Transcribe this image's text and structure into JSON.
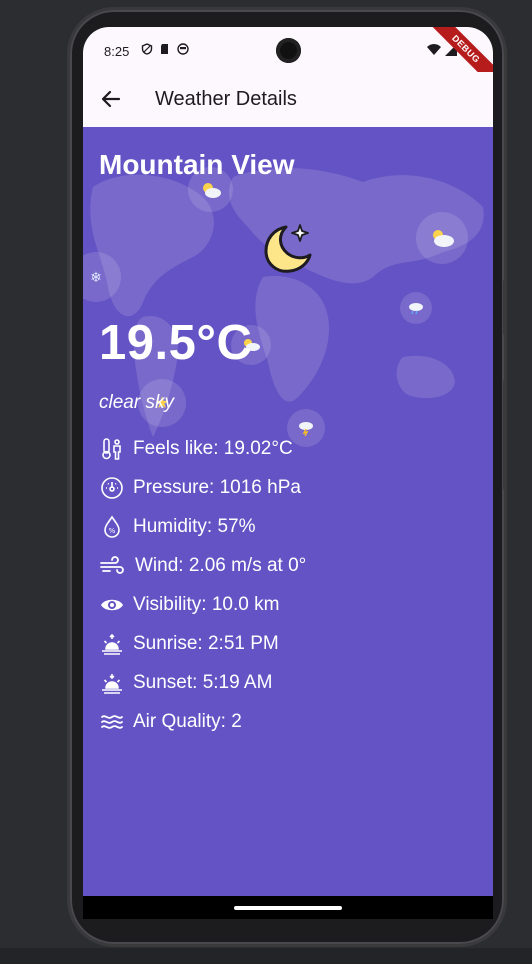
{
  "status_bar": {
    "time": "8:25",
    "icons_left": [
      "shield-icon",
      "sd-card-icon",
      "face-icon"
    ],
    "icons_right": [
      "wifi-icon",
      "signal-icon",
      "battery-icon"
    ],
    "debug_label": "DEBUG"
  },
  "app_bar": {
    "back_icon": "arrow-left-icon",
    "title": "Weather Details"
  },
  "weather": {
    "city": "Mountain View",
    "condition_icon": "moon-star-icon",
    "temperature": "19.5°C",
    "description": "clear sky",
    "details": [
      {
        "icon": "thermometer-person-icon",
        "label": "Feels like: 19.02°C"
      },
      {
        "icon": "gauge-icon",
        "label": "Pressure: 1016 hPa"
      },
      {
        "icon": "humidity-drop-icon",
        "label": "Humidity: 57%"
      },
      {
        "icon": "wind-icon",
        "label": "Wind: 2.06 m/s at 0°"
      },
      {
        "icon": "eye-icon",
        "label": "Visibility: 10.0 km"
      },
      {
        "icon": "sunrise-icon",
        "label": "Sunrise: 2:51 PM"
      },
      {
        "icon": "sunset-icon",
        "label": "Sunset: 5:19 AM"
      },
      {
        "icon": "air-waves-icon",
        "label": "Air Quality: 2"
      }
    ]
  },
  "colors": {
    "content_bg": "#6453c4",
    "appbar_bg": "#fdf7fe",
    "moon": "#fde68a"
  }
}
